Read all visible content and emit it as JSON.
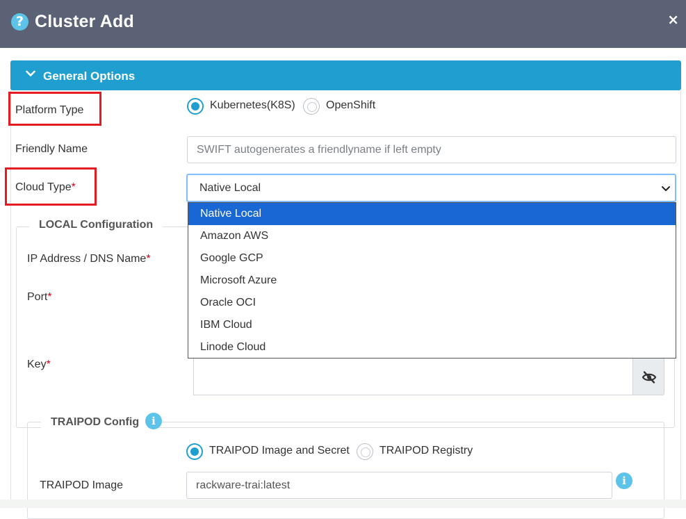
{
  "dialog": {
    "title": "Cluster Add",
    "help_icon": "question-circle-icon",
    "close_icon": "close-icon",
    "close_glyph": "×"
  },
  "general_options": {
    "title": "General Options",
    "chevron_icon": "chevron-down-icon"
  },
  "platform_type": {
    "label": "Platform Type",
    "options": [
      {
        "label": "Kubernetes(K8S)",
        "checked": true
      },
      {
        "label": "OpenShift",
        "checked": false
      }
    ]
  },
  "friendly_name": {
    "label": "Friendly Name",
    "value": "",
    "placeholder": "SWIFT autogenerates a friendlyname if left empty"
  },
  "cloud_type": {
    "label": "Cloud Type",
    "required_marker": "*",
    "selected": "Native Local",
    "options": [
      "Native Local",
      "Amazon AWS",
      "Google GCP",
      "Microsoft Azure",
      "Oracle OCI",
      "IBM Cloud",
      "Linode Cloud"
    ]
  },
  "local_config": {
    "legend": "LOCAL Configuration",
    "ip_label": "IP Address / DNS Name",
    "port_label": "Port",
    "key_label": "Key",
    "required_marker": "*",
    "key_toggle_icon": "eye-slash-icon"
  },
  "traipod_config": {
    "legend": "TRAIPOD Config",
    "info_icon": "info-icon",
    "options": [
      {
        "label": "TRAIPOD Image and Secret",
        "checked": true
      },
      {
        "label": "TRAIPOD Registry",
        "checked": false
      }
    ],
    "image_label": "TRAIPOD Image",
    "image_value": "rackware-trai:latest"
  },
  "colors": {
    "titlebar": "#5b6275",
    "section_header": "#1f9fcf",
    "selected_option": "#1967d2",
    "required": "#d9001b",
    "highlight_box": "#e31b23"
  }
}
